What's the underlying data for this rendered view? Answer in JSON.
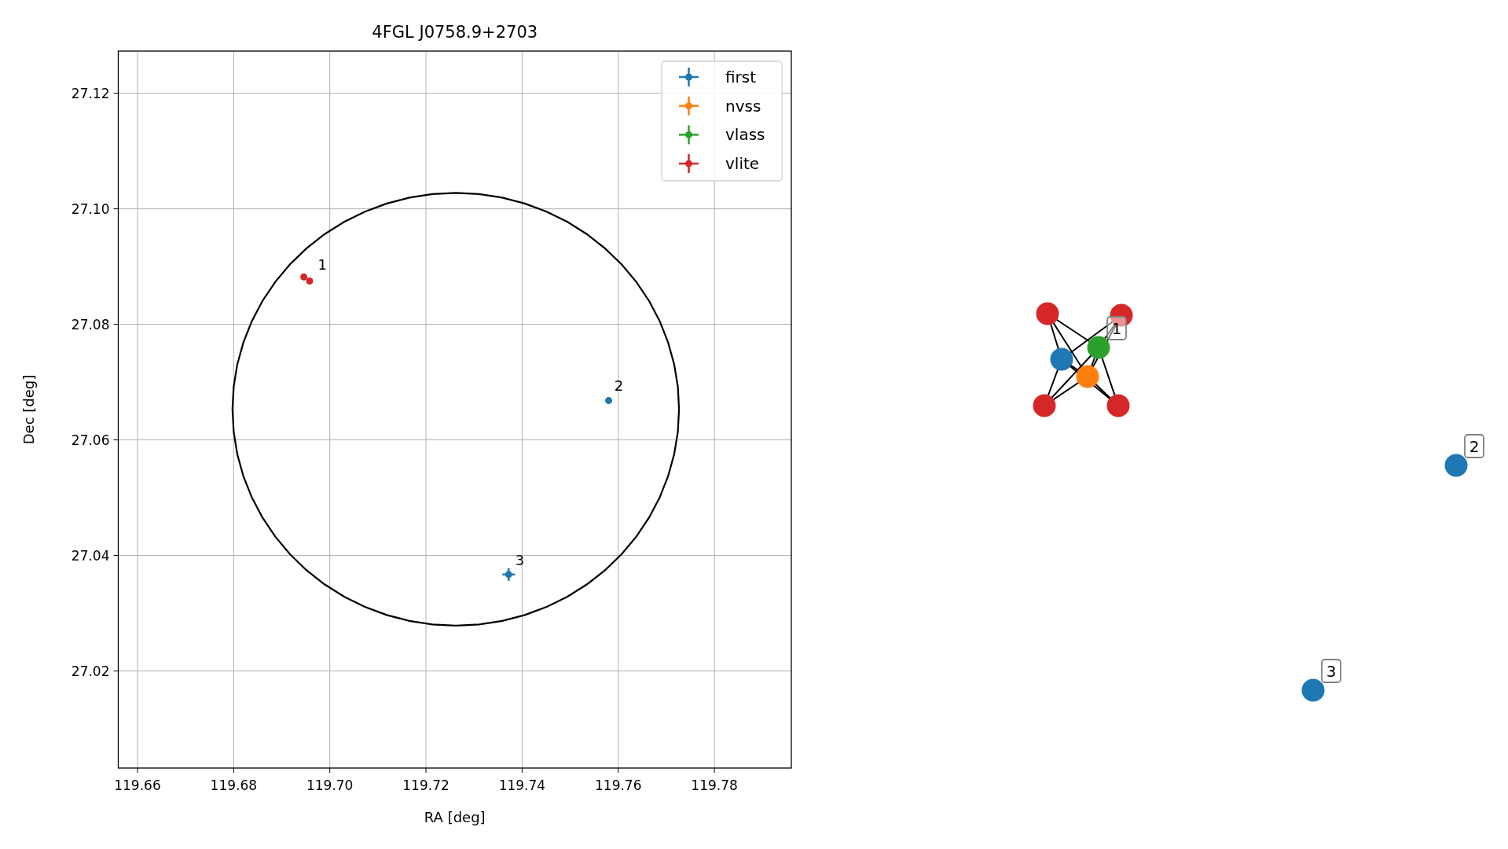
{
  "plot": {
    "chart_data": {
      "type": "scatter",
      "title": "4FGL J0758.9+2703",
      "xlabel": "RA [deg]",
      "ylabel": "Dec [deg]",
      "xlim": [
        119.656,
        119.796
      ],
      "ylim": [
        27.0032,
        27.1273
      ],
      "xticks": [
        {
          "value": 119.66,
          "label": "119.66"
        },
        {
          "value": 119.68,
          "label": "119.68"
        },
        {
          "value": 119.7,
          "label": "119.70"
        },
        {
          "value": 119.72,
          "label": "119.72"
        },
        {
          "value": 119.74,
          "label": "119.74"
        },
        {
          "value": 119.76,
          "label": "119.76"
        },
        {
          "value": 119.78,
          "label": "119.78"
        }
      ],
      "yticks": [
        {
          "value": 27.02,
          "label": "27.02"
        },
        {
          "value": 27.04,
          "label": "27.04"
        },
        {
          "value": 27.06,
          "label": "27.06"
        },
        {
          "value": 27.08,
          "label": "27.08"
        },
        {
          "value": 27.1,
          "label": "27.10"
        },
        {
          "value": 27.12,
          "label": "27.12"
        }
      ],
      "x": [
        119.6946,
        119.6958,
        119.7372,
        119.758
      ],
      "series": [
        {
          "name": "first",
          "color": "#1f77b4",
          "values": [
            null,
            null,
            27.0367,
            27.0668
          ]
        },
        {
          "name": "nvss",
          "color": "#ff7f0e",
          "values": [
            null,
            null,
            null,
            null
          ]
        },
        {
          "name": "vlass",
          "color": "#2ca02c",
          "values": [
            null,
            null,
            null,
            null
          ]
        },
        {
          "name": "vlite",
          "color": "#d62728",
          "values": [
            27.0882,
            27.0875,
            null,
            null
          ]
        }
      ],
      "annotations": [
        {
          "text": "1"
        },
        {
          "text": "2"
        },
        {
          "text": "3"
        }
      ],
      "grid": true,
      "legend": true
    }
  },
  "graph": {
    "nodes": [
      {
        "color": "#d62728"
      },
      {
        "color": "#d62728"
      },
      {
        "color": "#d62728"
      },
      {
        "color": "#d62728"
      },
      {
        "color": "#1f77b4"
      },
      {
        "color": "#ff7f0e"
      },
      {
        "color": "#2ca02c"
      },
      {
        "color": "#1f77b4"
      },
      {
        "color": "#1f77b4"
      }
    ],
    "labels": [
      "1",
      "2",
      "3"
    ]
  }
}
